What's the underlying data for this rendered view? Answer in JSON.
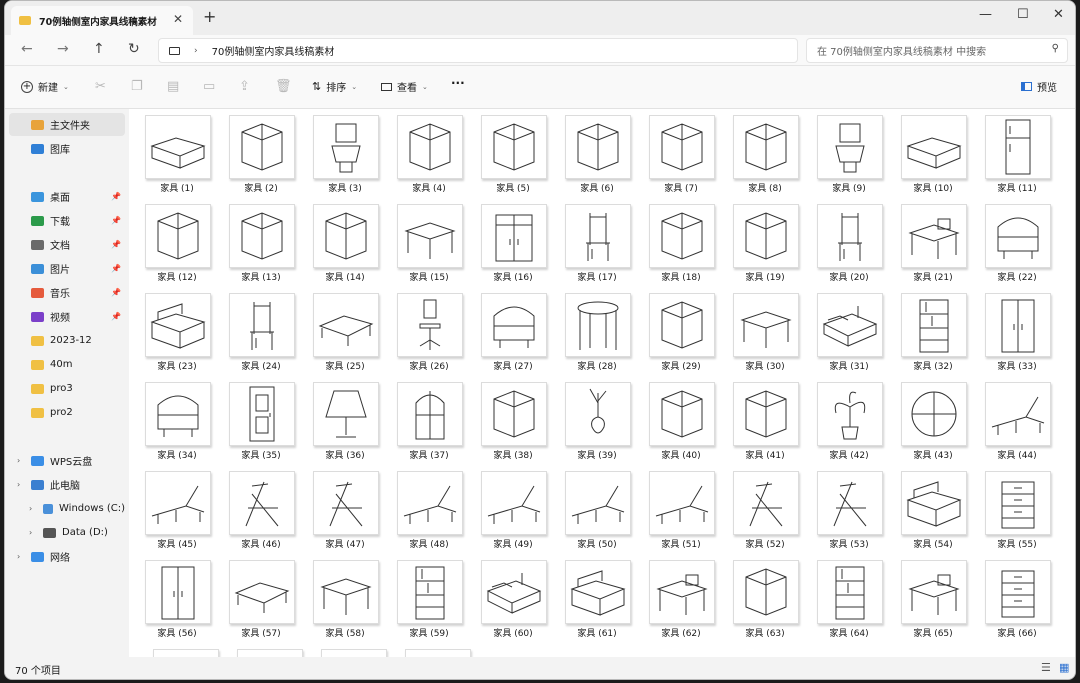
{
  "window": {
    "tab_title": "70例轴侧室内家具线稿素材",
    "close": "✕",
    "new_tab": "+",
    "minimize": "—",
    "maximize": "☐",
    "close_window": "✕"
  },
  "address": {
    "path": "70例轴侧室内家具线稿素材",
    "search_placeholder": "在 70例轴侧室内家具线稿素材 中搜索"
  },
  "toolbar": {
    "new_label": "新建",
    "sort_label": "排序",
    "view_label": "查看",
    "more": "···",
    "preview_label": "预览"
  },
  "sidebar": {
    "items": [
      {
        "label": "主文件夹",
        "icon": "home-icon",
        "color": "#e8a33a",
        "selected": true,
        "pinned": false,
        "chevron": false
      },
      {
        "label": "图库",
        "icon": "gallery-icon",
        "color": "#2f7fd6",
        "selected": false,
        "pinned": false,
        "chevron": false
      },
      {
        "label": "桌面",
        "icon": "desktop-icon",
        "color": "#3b95dd",
        "selected": false,
        "pinned": true,
        "chevron": false
      },
      {
        "label": "下载",
        "icon": "download-icon",
        "color": "#2b9a4a",
        "selected": false,
        "pinned": true,
        "chevron": false
      },
      {
        "label": "文档",
        "icon": "document-icon",
        "color": "#6a6a6a",
        "selected": false,
        "pinned": true,
        "chevron": false
      },
      {
        "label": "图片",
        "icon": "pictures-icon",
        "color": "#3b8fd8",
        "selected": false,
        "pinned": true,
        "chevron": false
      },
      {
        "label": "音乐",
        "icon": "music-icon",
        "color": "#e55a3c",
        "selected": false,
        "pinned": true,
        "chevron": false
      },
      {
        "label": "视频",
        "icon": "video-icon",
        "color": "#7b3fc9",
        "selected": false,
        "pinned": true,
        "chevron": false
      },
      {
        "label": "2023-12",
        "icon": "folder-icon",
        "color": "#f0c043",
        "selected": false,
        "pinned": false,
        "chevron": false
      },
      {
        "label": "40m",
        "icon": "folder-icon",
        "color": "#f0c043",
        "selected": false,
        "pinned": false,
        "chevron": false
      },
      {
        "label": "pro3",
        "icon": "folder-icon",
        "color": "#f0c043",
        "selected": false,
        "pinned": false,
        "chevron": false
      },
      {
        "label": "pro2",
        "icon": "folder-icon",
        "color": "#f0c043",
        "selected": false,
        "pinned": false,
        "chevron": false
      },
      {
        "label": "WPS云盘",
        "icon": "cloud-icon",
        "color": "#3a8ee6",
        "selected": false,
        "pinned": false,
        "chevron": true
      },
      {
        "label": "此电脑",
        "icon": "pc-icon",
        "color": "#3b7fd0",
        "selected": false,
        "pinned": false,
        "chevron": true
      },
      {
        "label": "Windows (C:)",
        "icon": "drive-icon",
        "color": "#4a90d9",
        "selected": false,
        "pinned": false,
        "chevron": true
      },
      {
        "label": "Data (D:)",
        "icon": "drive-icon",
        "color": "#555555",
        "selected": false,
        "pinned": false,
        "chevron": true
      },
      {
        "label": "网络",
        "icon": "network-icon",
        "color": "#3a8ee6",
        "selected": false,
        "pinned": false,
        "chevron": true
      }
    ]
  },
  "files": [
    {
      "name": "家具 (1)",
      "icon": "bathtub-icon"
    },
    {
      "name": "家具 (2)",
      "icon": "shelf-jars-icon"
    },
    {
      "name": "家具 (3)",
      "icon": "toilet-icon"
    },
    {
      "name": "家具 (4)",
      "icon": "paper-holder-icon"
    },
    {
      "name": "家具 (5)",
      "icon": "shower-icon"
    },
    {
      "name": "家具 (6)",
      "icon": "basin-icon"
    },
    {
      "name": "家具 (7)",
      "icon": "towel-rack-icon"
    },
    {
      "name": "家具 (8)",
      "icon": "washing-machine-icon"
    },
    {
      "name": "家具 (9)",
      "icon": "toilet-icon"
    },
    {
      "name": "家具 (10)",
      "icon": "bathtub-icon"
    },
    {
      "name": "家具 (11)",
      "icon": "fridge-icon"
    },
    {
      "name": "家具 (12)",
      "icon": "oven-icon"
    },
    {
      "name": "家具 (13)",
      "icon": "teapot-icon"
    },
    {
      "name": "家具 (14)",
      "icon": "microwave-icon"
    },
    {
      "name": "家具 (15)",
      "icon": "table-icon"
    },
    {
      "name": "家具 (16)",
      "icon": "cabinet-icon"
    },
    {
      "name": "家具 (17)",
      "icon": "chair-icon"
    },
    {
      "name": "家具 (18)",
      "icon": "stove-icon"
    },
    {
      "name": "家具 (19)",
      "icon": "range-hood-icon"
    },
    {
      "name": "家具 (20)",
      "icon": "chair-icon"
    },
    {
      "name": "家具 (21)",
      "icon": "desk-icon"
    },
    {
      "name": "家具 (22)",
      "icon": "armchair-icon"
    },
    {
      "name": "家具 (23)",
      "icon": "sofa-icon"
    },
    {
      "name": "家具 (24)",
      "icon": "chair-icon"
    },
    {
      "name": "家具 (25)",
      "icon": "coffee-table-icon"
    },
    {
      "name": "家具 (26)",
      "icon": "office-chair-icon"
    },
    {
      "name": "家具 (27)",
      "icon": "armchair-icon"
    },
    {
      "name": "家具 (28)",
      "icon": "round-table-icon"
    },
    {
      "name": "家具 (29)",
      "icon": "nightstand-icon"
    },
    {
      "name": "家具 (30)",
      "icon": "table-icon"
    },
    {
      "name": "家具 (31)",
      "icon": "bed-icon"
    },
    {
      "name": "家具 (32)",
      "icon": "bookshelf-icon"
    },
    {
      "name": "家具 (33)",
      "icon": "wardrobe-icon"
    },
    {
      "name": "家具 (34)",
      "icon": "armchair-icon"
    },
    {
      "name": "家具 (35)",
      "icon": "door-icon"
    },
    {
      "name": "家具 (36)",
      "icon": "lamp-icon"
    },
    {
      "name": "家具 (37)",
      "icon": "window-icon"
    },
    {
      "name": "家具 (38)",
      "icon": "cake-icon"
    },
    {
      "name": "家具 (39)",
      "icon": "vase-icon"
    },
    {
      "name": "家具 (40)",
      "icon": "frame-icon"
    },
    {
      "name": "家具 (41)",
      "icon": "tiles-icon"
    },
    {
      "name": "家具 (42)",
      "icon": "plant-icon"
    },
    {
      "name": "家具 (43)",
      "icon": "round-window-icon"
    },
    {
      "name": "家具 (44)",
      "icon": "lounger-icon"
    },
    {
      "name": "家具 (45)",
      "icon": "lounger-icon"
    },
    {
      "name": "家具 (46)",
      "icon": "deck-chair-icon"
    },
    {
      "name": "家具 (47)",
      "icon": "deck-chair-icon"
    },
    {
      "name": "家具 (48)",
      "icon": "lounger-icon"
    },
    {
      "name": "家具 (49)",
      "icon": "lounger-icon"
    },
    {
      "name": "家具 (50)",
      "icon": "lounger-icon"
    },
    {
      "name": "家具 (51)",
      "icon": "lounger-icon"
    },
    {
      "name": "家具 (52)",
      "icon": "deck-chair-icon"
    },
    {
      "name": "家具 (53)",
      "icon": "deck-chair-icon"
    },
    {
      "name": "家具 (54)",
      "icon": "sofa-icon"
    },
    {
      "name": "家具 (55)",
      "icon": "drawer-icon"
    },
    {
      "name": "家具 (56)",
      "icon": "wardrobe-icon"
    },
    {
      "name": "家具 (57)",
      "icon": "coffee-table-icon"
    },
    {
      "name": "家具 (58)",
      "icon": "table-icon"
    },
    {
      "name": "家具 (59)",
      "icon": "bookshelf-icon"
    },
    {
      "name": "家具 (60)",
      "icon": "bed-icon"
    },
    {
      "name": "家具 (61)",
      "icon": "sofa-icon"
    },
    {
      "name": "家具 (62)",
      "icon": "desk-icon"
    },
    {
      "name": "家具 (63)",
      "icon": "file-cabinet-icon"
    },
    {
      "name": "家具 (64)",
      "icon": "bookshelf-icon"
    },
    {
      "name": "家具 (65)",
      "icon": "desk-icon"
    },
    {
      "name": "家具 (66)",
      "icon": "drawer-icon"
    }
  ],
  "status": {
    "count": "70 个项目"
  }
}
